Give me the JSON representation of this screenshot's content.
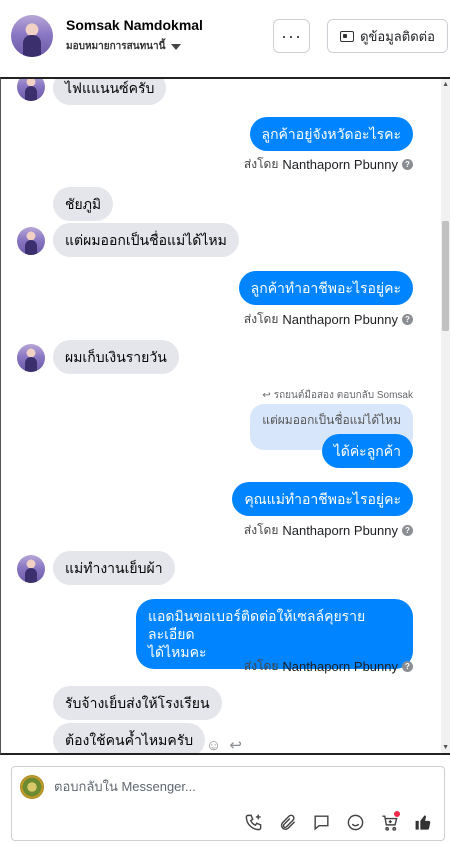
{
  "header": {
    "contact_name": "Somsak Namdokmal",
    "assignment": "มอบหมายการสนทนานี้",
    "more_label": "···",
    "contact_info_label": "ดูข้อมูลติดต่อ"
  },
  "messages": [
    {
      "id": "m1",
      "side": "in",
      "text": "ไฟแแนนซ์ครับ"
    },
    {
      "id": "m2",
      "side": "out",
      "text": "ลูกค้าอยู่จังหวัดอะไรคะ"
    },
    {
      "id": "m3",
      "side": "in",
      "text": "ชัยภูมิ"
    },
    {
      "id": "m4",
      "side": "in",
      "text": "แต่ผมออกเป็นชื่อแม่ได้ไหม"
    },
    {
      "id": "m5",
      "side": "out",
      "text": "ลูกค้าทำอาชีพอะไรอยู่คะ"
    },
    {
      "id": "m6",
      "side": "in",
      "text": "ผมเก็บเงินรายวัน"
    },
    {
      "id": "m7",
      "side": "out",
      "text": "ได้ค่ะลูกค้า"
    },
    {
      "id": "m8",
      "side": "out",
      "text": "คุณแม่ทำอาชีพอะไรอยู่คะ"
    },
    {
      "id": "m9",
      "side": "in",
      "text": "แม่ทำงานเย็บผ้า"
    },
    {
      "id": "m10",
      "side": "out",
      "line1": "แอดมินขอเบอร์ติดต่อให้เซลล์คุยรายละเอียด",
      "line2": "ได้ไหมคะ"
    },
    {
      "id": "m11",
      "side": "in",
      "text": "รับจ้างเย็บส่งให้โรงเรียน"
    },
    {
      "id": "m12",
      "side": "in",
      "text": "ต้องใช้คนค้ำไหมครับ"
    }
  ],
  "sent_by": {
    "prefix": "ส่งโดย",
    "name": "Nanthaporn Pbunny",
    "help": "?"
  },
  "reply": {
    "header": "รถยนต์มือสอง ตอบกลับ Somsak",
    "quoted": "แต่ผมออกเป็นชื่อแม่ได้ไหม"
  },
  "composer": {
    "placeholder": "ตอบกลับใน Messenger..."
  },
  "icons": {
    "more": "more-horizontal-icon",
    "contact_card": "contact-card-icon",
    "dropdown": "caret-down-icon",
    "help": "question-mark-icon",
    "reply_arrow": "reply-arrow-icon",
    "emoji": "emoji-icon",
    "phone": "phone-icon",
    "attach": "paperclip-icon",
    "saved_reply": "chat-bubble-icon",
    "cart": "shopping-cart-icon",
    "like": "thumbs-up-icon"
  },
  "colors": {
    "outgoing_bubble": "#0084ff",
    "incoming_bubble": "#e4e6eb",
    "quote_bubble": "#d8e6fb",
    "notification_dot": "#f02849"
  }
}
